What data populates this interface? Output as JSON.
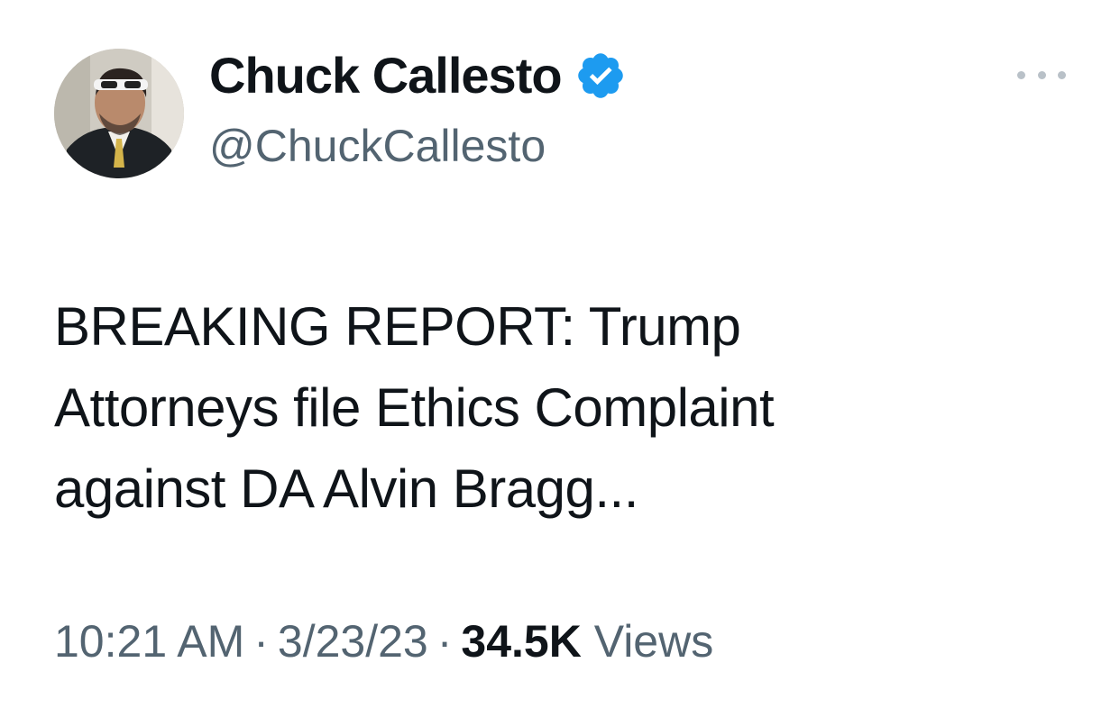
{
  "author": {
    "name": "Chuck Callesto",
    "handle": "@ChuckCallesto",
    "verified": true,
    "verified_color": "#1d9bf0",
    "avatar_icon": "profile-photo"
  },
  "tweet": {
    "text_lines": [
      "BREAKING REPORT: Trump",
      "Attorneys file Ethics Complaint",
      "against DA Alvin Bragg..."
    ]
  },
  "meta": {
    "time": "10:21 AM",
    "separator": "·",
    "date": "3/23/23",
    "views_count": "34.5K",
    "views_label": "Views"
  },
  "more_icon": "more-horizontal-icon"
}
